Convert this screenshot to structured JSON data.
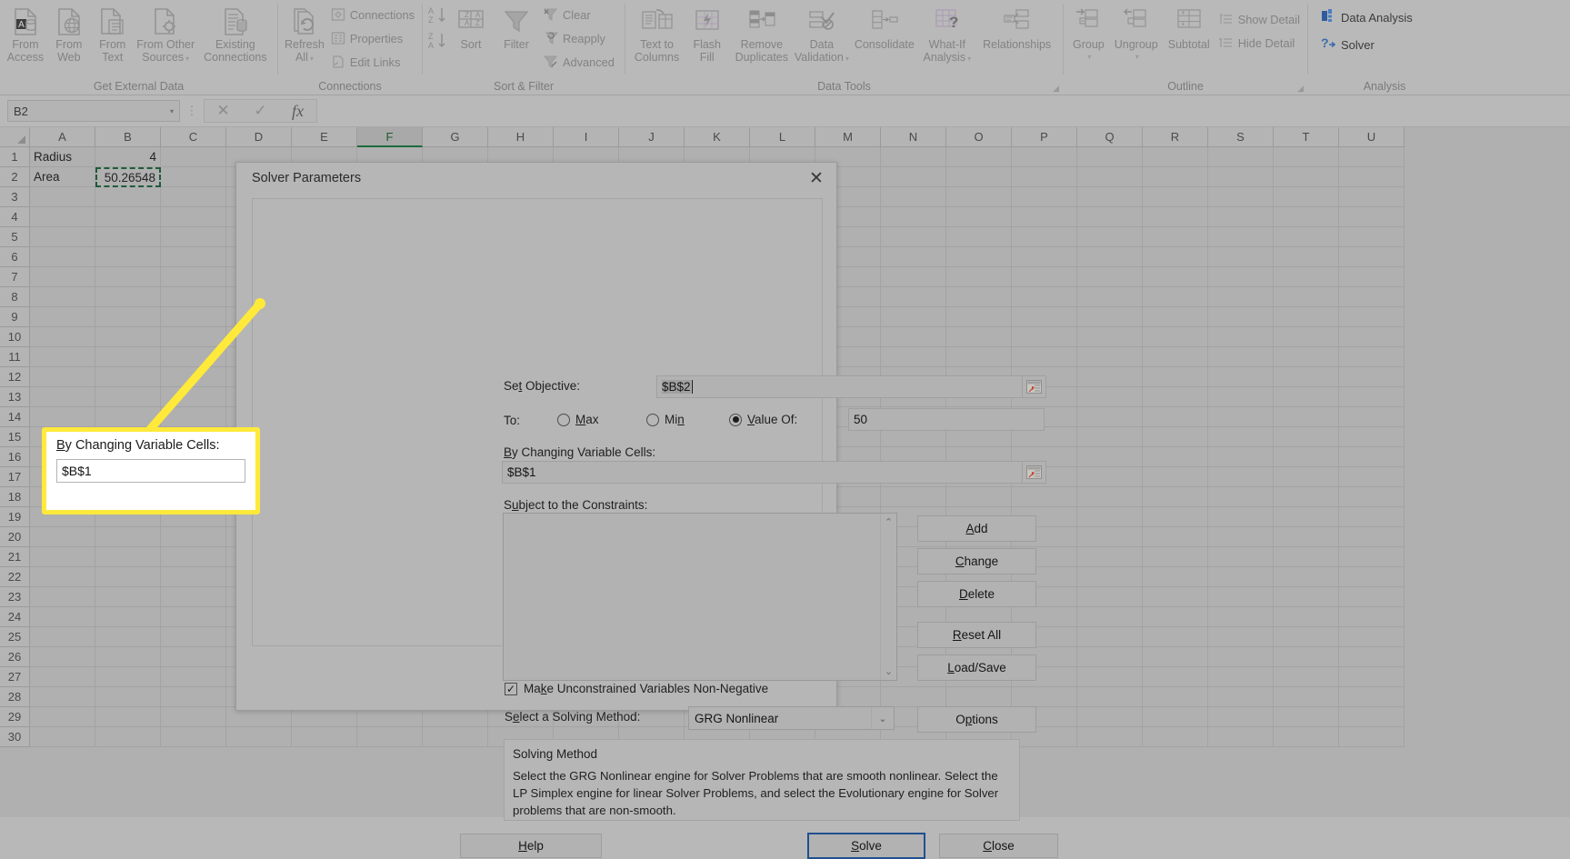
{
  "ribbon": {
    "groups": [
      {
        "label": "Get External Data",
        "buttons": [
          {
            "label_line1": "From",
            "label_line2": "Access",
            "icon": "from-access-icon"
          },
          {
            "label_line1": "From",
            "label_line2": "Web",
            "icon": "from-web-icon"
          },
          {
            "label_line1": "From",
            "label_line2": "Text",
            "icon": "from-text-icon"
          },
          {
            "label_line1": "From Other",
            "label_line2": "Sources",
            "icon": "from-other-sources-icon",
            "caret": true
          },
          {
            "label_line1": "Existing",
            "label_line2": "Connections",
            "icon": "existing-connections-icon"
          }
        ]
      },
      {
        "label": "Connections",
        "big": [
          {
            "label_line1": "Refresh",
            "label_line2": "All",
            "icon": "refresh-all-icon",
            "caret": true
          }
        ],
        "small": [
          {
            "label": "Connections",
            "icon": "connections-icon"
          },
          {
            "label": "Properties",
            "icon": "properties-icon"
          },
          {
            "label": "Edit Links",
            "icon": "edit-links-icon"
          }
        ]
      },
      {
        "label": "Sort & Filter",
        "buttons": [
          {
            "label_line1": "Sort",
            "label_line2": "",
            "icon": "sort-icon"
          },
          {
            "label_line1": "Filter",
            "label_line2": "",
            "icon": "filter-icon"
          }
        ],
        "small": [
          {
            "label": "Clear",
            "icon": "clear-filter-icon"
          },
          {
            "label": "Reapply",
            "icon": "reapply-filter-icon"
          },
          {
            "label": "Advanced",
            "icon": "advanced-filter-icon"
          }
        ],
        "sort_az": "sort-ascending-icon",
        "sort_za": "sort-descending-icon"
      },
      {
        "label": "Data Tools",
        "buttons": [
          {
            "label_line1": "Text to",
            "label_line2": "Columns",
            "icon": "text-to-columns-icon"
          },
          {
            "label_line1": "Flash",
            "label_line2": "Fill",
            "icon": "flash-fill-icon"
          },
          {
            "label_line1": "Remove",
            "label_line2": "Duplicates",
            "icon": "remove-duplicates-icon"
          },
          {
            "label_line1": "Data",
            "label_line2": "Validation",
            "icon": "data-validation-icon",
            "caret": true
          },
          {
            "label_line1": "Consolidate",
            "label_line2": "",
            "icon": "consolidate-icon"
          },
          {
            "label_line1": "What-If",
            "label_line2": "Analysis",
            "icon": "what-if-analysis-icon",
            "caret": true
          },
          {
            "label_line1": "Relationships",
            "label_line2": "",
            "icon": "relationships-icon"
          }
        ]
      },
      {
        "label": "Outline",
        "buttons": [
          {
            "label_line1": "Group",
            "label_line2": "",
            "icon": "group-icon",
            "caret": true
          },
          {
            "label_line1": "Ungroup",
            "label_line2": "",
            "icon": "ungroup-icon",
            "caret": true
          },
          {
            "label_line1": "Subtotal",
            "label_line2": "",
            "icon": "subtotal-icon"
          }
        ],
        "small": [
          {
            "label": "Show Detail",
            "icon": "show-detail-icon"
          },
          {
            "label": "Hide Detail",
            "icon": "hide-detail-icon"
          }
        ]
      },
      {
        "label": "Analysis",
        "small": [
          {
            "label": "Data Analysis",
            "icon": "data-analysis-icon"
          },
          {
            "label": "Solver",
            "icon": "solver-icon"
          }
        ]
      }
    ]
  },
  "formula_bar": {
    "name_box_value": "B2",
    "cancel_icon": "cancel-icon",
    "enter_icon": "enter-icon",
    "function_icon": "insert-function-icon",
    "formula_value": ""
  },
  "sheet": {
    "columns": [
      "A",
      "B",
      "C",
      "D",
      "E",
      "F",
      "G",
      "H",
      "I",
      "J",
      "K",
      "L",
      "M",
      "N",
      "O",
      "P",
      "Q",
      "R",
      "S",
      "T",
      "U"
    ],
    "selected_column": "F",
    "rows": [
      "1",
      "2",
      "3",
      "4",
      "5",
      "6",
      "7",
      "8",
      "9",
      "10",
      "11",
      "12",
      "13",
      "14",
      "15",
      "16",
      "17",
      "18",
      "19",
      "20",
      "21",
      "22",
      "23",
      "24",
      "25",
      "26",
      "27",
      "28",
      "29",
      "30"
    ],
    "cells": [
      {
        "row": 1,
        "a": "Radius",
        "b": "4"
      },
      {
        "row": 2,
        "a": "Area",
        "b": "50.26548"
      }
    ],
    "active_cell": "B2"
  },
  "dialog": {
    "title": "Solver Parameters",
    "close_icon": "close-icon",
    "set_objective_label": "Set Objective:",
    "set_objective_accel": "t",
    "set_objective_value": "$B$2",
    "objective_picker_icon": "range-picker-icon",
    "to_label": "To:",
    "radios": [
      {
        "label": "Max",
        "accel": "M",
        "selected": false
      },
      {
        "label": "Min",
        "accel": "n",
        "selected": false
      },
      {
        "label": "Value Of:",
        "accel": "V",
        "selected": true
      }
    ],
    "value_of_input": "50",
    "changing_cells_label": "By Changing Variable Cells:",
    "changing_cells_accel": "B",
    "changing_cells_value": "$B$1",
    "changing_picker_icon": "range-picker-icon",
    "constraints_label": "Subject to the Constraints:",
    "constraints_accel": "u",
    "constraints_items": [],
    "scroll_up_icon": "chevron-up-icon",
    "scroll_down_icon": "chevron-down-icon",
    "constraint_buttons": [
      {
        "label": "Add",
        "accel": "A"
      },
      {
        "label": "Change",
        "accel": "C"
      },
      {
        "label": "Delete",
        "accel": "D"
      },
      {
        "label": "Reset All",
        "accel": "R"
      },
      {
        "label": "Load/Save",
        "accel": "L"
      }
    ],
    "nonneg_checkbox_label": "Make Unconstrained Variables Non-Negative",
    "nonneg_checkbox_accel": "k",
    "nonneg_checked": true,
    "check_icon": "checkmark-icon",
    "solving_method_label": "Select a Solving Method:",
    "solving_method_accel": "e",
    "solving_method_value": "GRG Nonlinear",
    "solving_method_caret_icon": "chevron-down-icon",
    "options_button": "Options",
    "options_accel": "P",
    "method_box_heading": "Solving Method",
    "method_box_text": "Select the GRG Nonlinear engine for Solver Problems that are smooth nonlinear. Select the LP Simplex engine for linear Solver Problems, and select the Evolutionary engine for Solver problems that are non-smooth.",
    "footer_buttons": [
      {
        "label": "Help",
        "accel": "H",
        "name": "help-button",
        "default": false
      },
      {
        "label": "Solve",
        "accel": "S",
        "name": "solve-button",
        "default": true
      },
      {
        "label": "Close",
        "accel": "C",
        "name": "close-button",
        "default": false
      }
    ]
  },
  "callout": {
    "label": "By Changing Variable Cells:",
    "accel": "B",
    "value": "$B$1",
    "border_color": "#ffe93a"
  },
  "colors": {
    "accent_yellow": "#ffe93a",
    "default_button_blue": "#20508f",
    "marching_ants": "#1f5c3a"
  }
}
